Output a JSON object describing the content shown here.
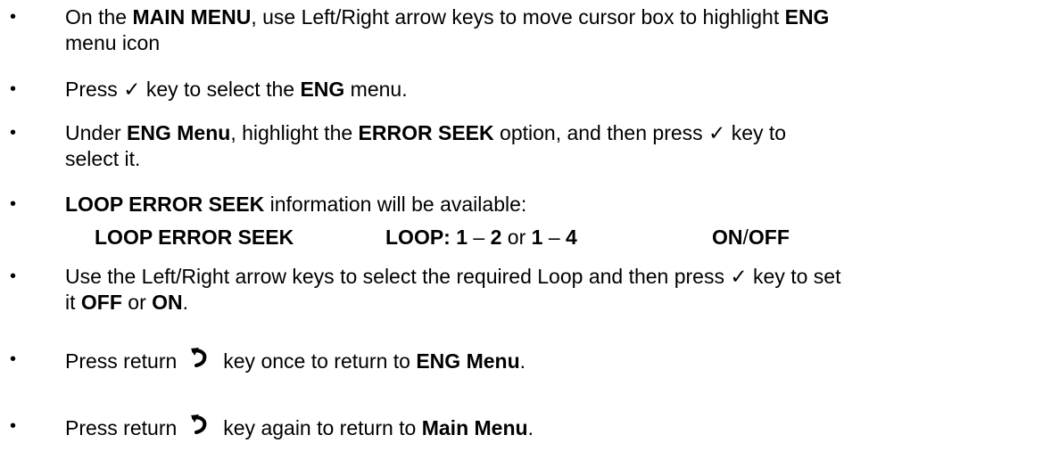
{
  "bullets": [
    {
      "p1": "On the ",
      "b1": "MAIN MENU",
      "p2": ", use Left/Right arrow keys to move cursor box to highlight ",
      "b2": "ENG",
      "p3": "menu icon"
    },
    {
      "p1": "Press ",
      "check": "✓",
      "p2": " key to select the ",
      "b1": "ENG",
      "p3": " menu."
    },
    {
      "p1": "Under ",
      "b1": "ENG Menu",
      "p2": ", highlight the ",
      "b2": "ERROR SEEK",
      "p3": " option, and then press ",
      "check": "✓",
      "p4": " key to",
      "p5": "select it."
    },
    {
      "b1": "LOOP ERROR SEEK",
      "p1": " information will be available:"
    },
    {
      "p1": "Use the Left/Right arrow keys to select the required Loop and then press ",
      "check": "✓",
      "p2": " key to set",
      "p3": "it ",
      "b1": "OFF",
      "p4": " or ",
      "b2": "ON",
      "p5": "."
    },
    {
      "p1": "Press return",
      "icon": "return-arrow-icon",
      "p2": "key once to return to ",
      "b1": "ENG Menu",
      "p3": "."
    },
    {
      "p1": "Press return",
      "icon": "return-arrow-icon",
      "p2": "key again to return to ",
      "b1": "Main Menu",
      "p3": "."
    }
  ],
  "loop_line": {
    "label": "LOOP ERROR SEEK",
    "loop_prefix": "LOOP: ",
    "n1": "1",
    "dash1": " – ",
    "n2": "2",
    "or": " or ",
    "n3": "1",
    "dash2": " – ",
    "n4": "4",
    "on": "ON",
    "slash": "/",
    "off": "OFF"
  }
}
